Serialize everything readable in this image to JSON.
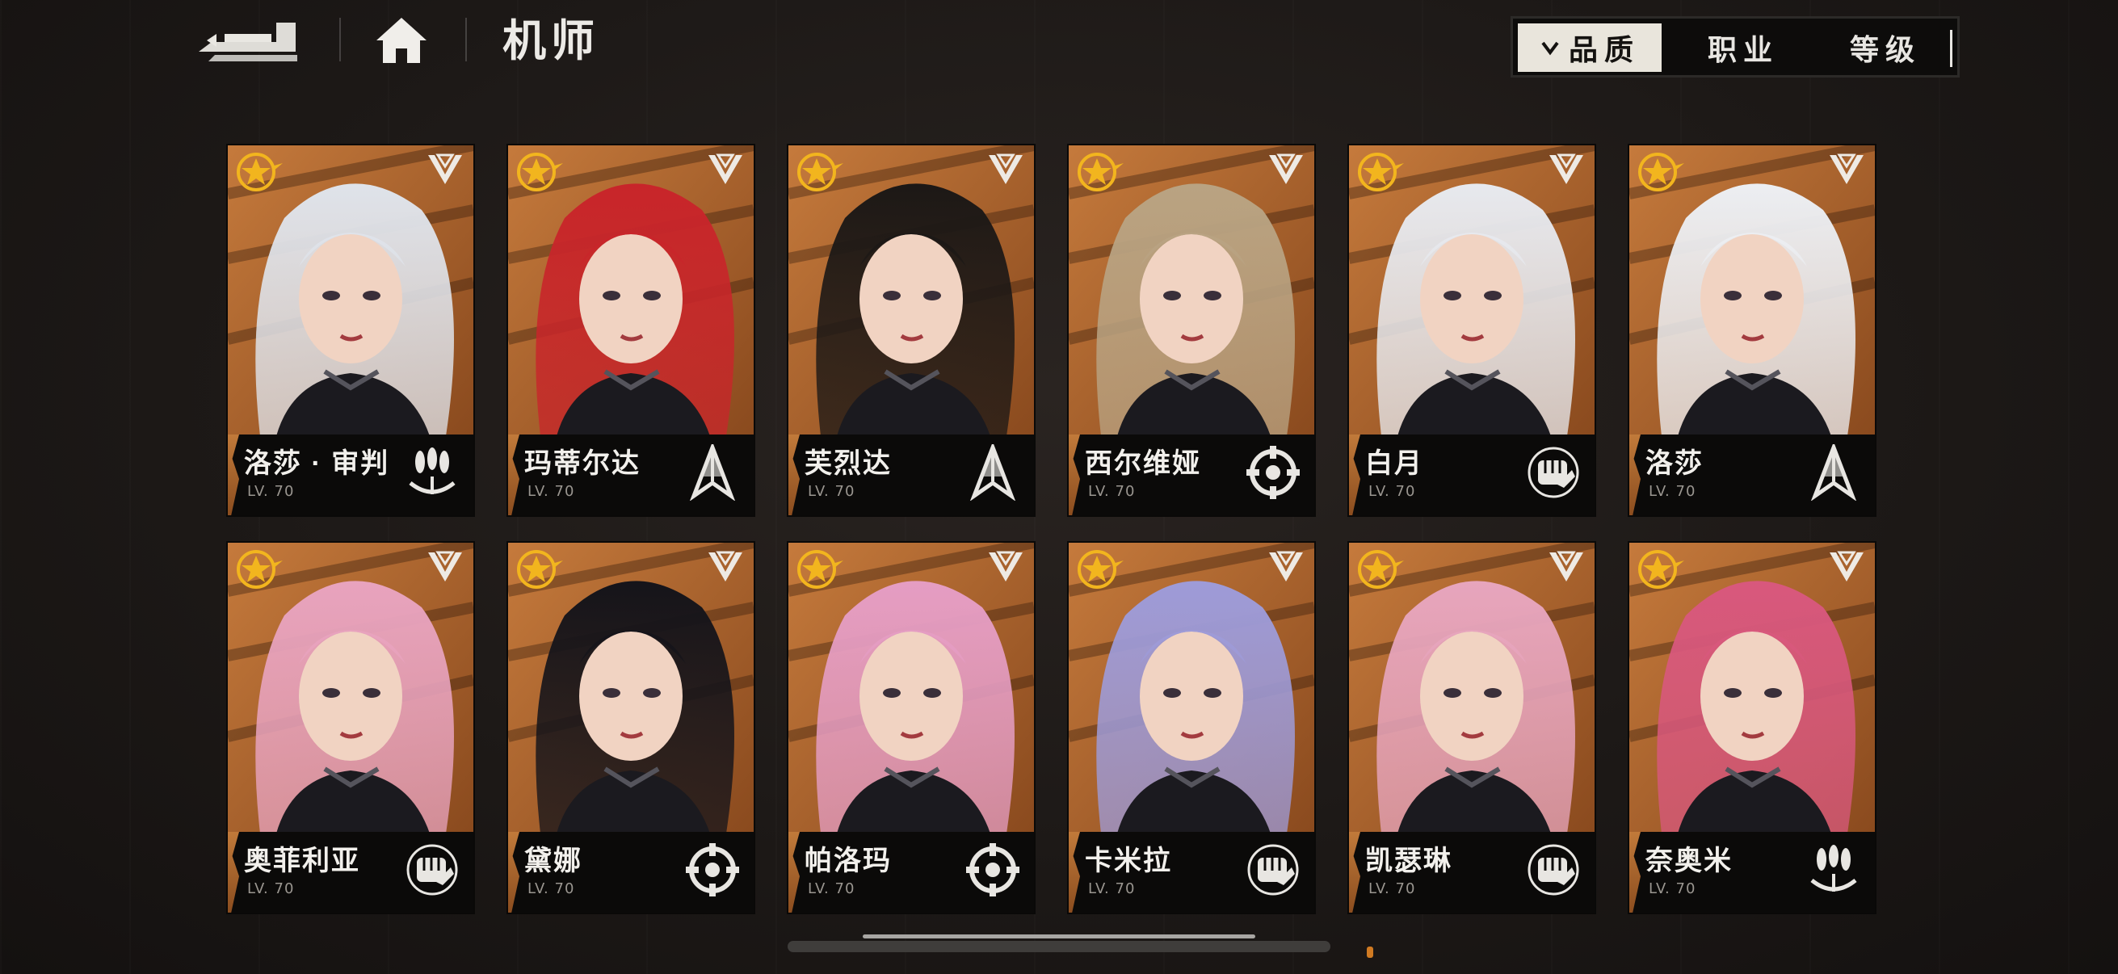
{
  "header": {
    "title": "机师"
  },
  "sort_tabs": [
    {
      "label": "品质",
      "active": true
    },
    {
      "label": "职业",
      "active": false
    },
    {
      "label": "等级",
      "active": false
    }
  ],
  "colors": {
    "card_bg": "#b4692f",
    "star_gold": "#f2b51e",
    "plate_bg": "#0b0a09",
    "accent_orange": "#d07a22"
  },
  "characters": [
    {
      "name": "洛莎 · 审判",
      "level": "LV. 70",
      "class_icon": "missile-cluster-icon",
      "hair": "#dfe3ea"
    },
    {
      "name": "玛蒂尔达",
      "level": "LV. 70",
      "class_icon": "arrow-spear-icon",
      "hair": "#c8252a"
    },
    {
      "name": "芙烈达",
      "level": "LV. 70",
      "class_icon": "arrow-spear-icon",
      "hair": "#1c1816"
    },
    {
      "name": "西尔维娅",
      "level": "LV. 70",
      "class_icon": "crosshair-gear-icon",
      "hair": "#b9a382"
    },
    {
      "name": "白月",
      "level": "LV. 70",
      "class_icon": "fist-icon",
      "hair": "#e7e9ee"
    },
    {
      "name": "洛莎",
      "level": "LV. 70",
      "class_icon": "arrow-spear-icon",
      "hair": "#eceef2"
    },
    {
      "name": "奥菲利亚",
      "level": "LV. 70",
      "class_icon": "fist-icon",
      "hair": "#e8a3be"
    },
    {
      "name": "黛娜",
      "level": "LV. 70",
      "class_icon": "crosshair-gear-icon",
      "hair": "#15141a"
    },
    {
      "name": "帕洛玛",
      "level": "LV. 70",
      "class_icon": "crosshair-gear-icon",
      "hair": "#e59dc3"
    },
    {
      "name": "卡米拉",
      "level": "LV. 70",
      "class_icon": "fist-icon",
      "hair": "#9e9bd8"
    },
    {
      "name": "凯瑟琳",
      "level": "LV. 70",
      "class_icon": "fist-icon",
      "hair": "#e7a5bd"
    },
    {
      "name": "奈奥米",
      "level": "LV. 70",
      "class_icon": "missile-cluster-icon",
      "hair": "#d8587d"
    }
  ]
}
